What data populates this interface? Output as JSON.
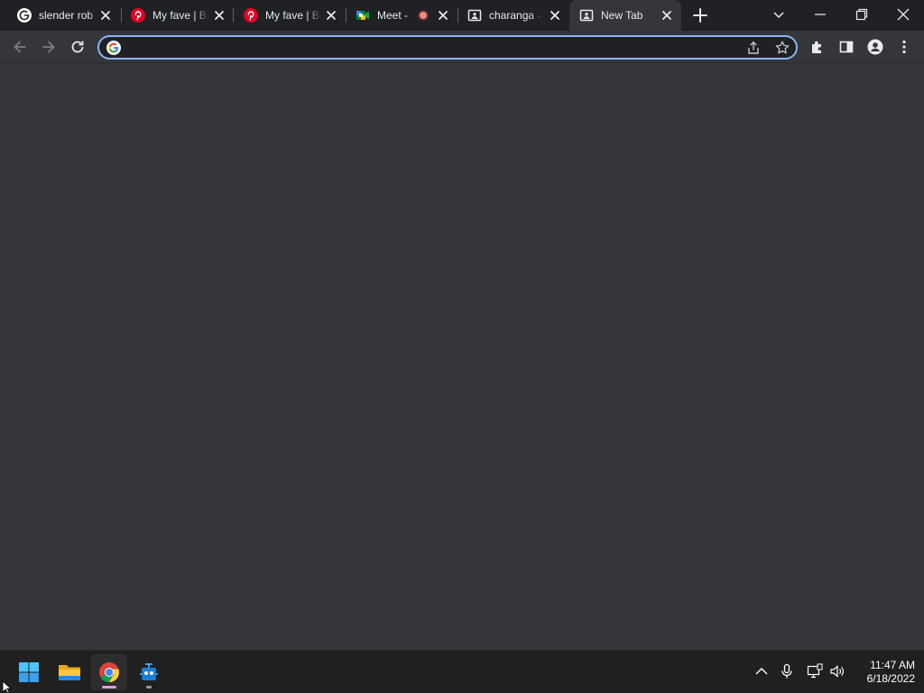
{
  "browser": {
    "tabs": [
      {
        "title": "slender rob",
        "favicon": "google-g-icon",
        "active": false
      },
      {
        "title": "My fave | Bl",
        "favicon": "pinterest-icon",
        "active": false
      },
      {
        "title": "My fave | Bl",
        "favicon": "pinterest-icon",
        "active": false
      },
      {
        "title": "Meet -",
        "favicon": "google-meet-icon",
        "active": false,
        "recording": true
      },
      {
        "title": "charanga -",
        "favicon": "classroom-icon",
        "active": false
      },
      {
        "title": "New Tab",
        "favicon": "classroom-icon",
        "active": true
      }
    ],
    "omnibox": {
      "value": "",
      "placeholder": ""
    },
    "colors": {
      "frame": "#202124",
      "toolbar": "#35363a",
      "focus_ring": "#8ab4f8",
      "pinterest": "#e60023"
    }
  },
  "taskbar": {
    "apps": [
      {
        "name": "start-button"
      },
      {
        "name": "file-explorer"
      },
      {
        "name": "chrome",
        "active": true
      },
      {
        "name": "app"
      }
    ],
    "clock": {
      "time": "11:47 AM",
      "date": "6/18/2022"
    }
  }
}
